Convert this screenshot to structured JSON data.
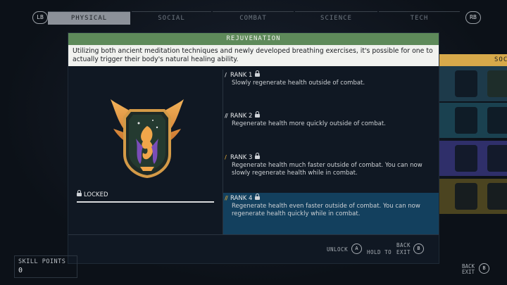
{
  "tabs": {
    "lb": "LB",
    "rb": "RB",
    "items": [
      "PHYSICAL",
      "SOCIAL",
      "COMBAT",
      "SCIENCE",
      "TECH"
    ]
  },
  "side_panel": {
    "header": "SOC"
  },
  "dialog": {
    "title": "REJUVENATION",
    "description": "Utilizing both ancient meditation techniques and newly developed breathing exercises, it's possible for one to actually trigger their body's natural healing ability.",
    "locked_label": "LOCKED",
    "ranks": [
      {
        "label": "RANK 1",
        "text": "Slowly regenerate health outside of combat."
      },
      {
        "label": "RANK 2",
        "text": "Regenerate health more quickly outside of combat."
      },
      {
        "label": "RANK 3",
        "text": "Regenerate health much faster outside of combat. You can now slowly regenerate health while in combat."
      },
      {
        "label": "RANK 4",
        "text": "Regenerate health even faster outside of combat. You can now regenerate health quickly while in combat."
      }
    ],
    "footer": {
      "unlock": "UNLOCK",
      "unlock_key": "A",
      "back": "BACK",
      "hold_to": "HOLD TO",
      "exit": "EXIT",
      "back_key": "B"
    }
  },
  "skill_points": {
    "label": "SKILL POINTS",
    "value": "0"
  },
  "bottom_right": {
    "back": "BACK",
    "exit": "EXIT",
    "key": "B"
  },
  "colors": {
    "title_bar": "#5e8a5a",
    "active_tab": "#8c9199",
    "selected_rank": "#13405e",
    "accent_gold": "#d7a94a"
  },
  "icons": [
    "phoenix-emblem-icon",
    "lock-icon",
    "rank-bars-icon"
  ]
}
